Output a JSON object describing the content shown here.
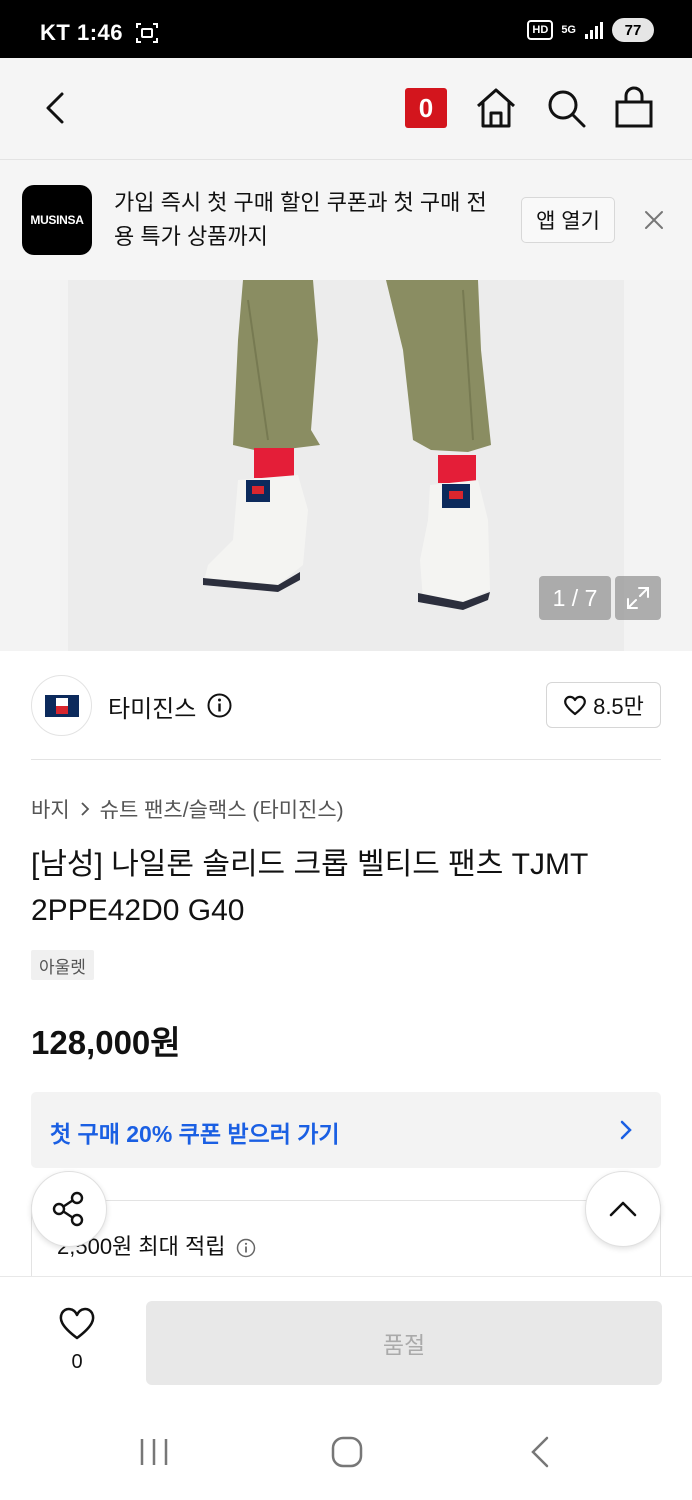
{
  "status_bar": {
    "carrier": "KT",
    "time": "1:46",
    "hd": "HD",
    "network": "5G",
    "battery": "77"
  },
  "top_nav": {
    "cart_count": "0"
  },
  "app_banner": {
    "logo_text": "MUSINSA",
    "message": "가입 즉시 첫 구매 할인 쿠폰과 첫 구매 전용 특가 상품까지",
    "open_label": "앱 열기"
  },
  "gallery": {
    "counter": "1 / 7"
  },
  "brand": {
    "name": "타미진스",
    "like_count": "8.5만"
  },
  "breadcrumb": {
    "category": "바지",
    "subcategory": "슈트 팬츠/슬랙스 (타미진스)"
  },
  "product": {
    "title": "[남성] 나일론 솔리드 크롭 벨티드 팬츠 TJMT 2PPE42D0 G40",
    "tag": "아울렛",
    "price": "128,000원"
  },
  "coupon": {
    "label": "첫 구매 20% 쿠폰 받으러 가기"
  },
  "points": {
    "label": "2,500원 최대 적립"
  },
  "bottom_bar": {
    "wish_count": "0",
    "soldout_label": "품절"
  },
  "colors": {
    "brand_red": "#d3151d",
    "coupon_blue": "#1a5fe3",
    "tommy_navy": "#0c2a5c",
    "tommy_red": "#d8262e"
  }
}
